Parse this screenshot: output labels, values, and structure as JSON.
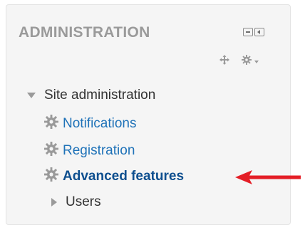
{
  "block": {
    "title": "ADMINISTRATION",
    "tree": {
      "root_label": "Site administration",
      "items": [
        {
          "label": "Notifications"
        },
        {
          "label": "Registration"
        },
        {
          "label": "Advanced features",
          "highlighted": true
        },
        {
          "label": "Users"
        }
      ]
    }
  },
  "colors": {
    "link": "#1f72b8",
    "highlight_arrow": "#e41e26",
    "header_text": "#9a9a9a"
  }
}
